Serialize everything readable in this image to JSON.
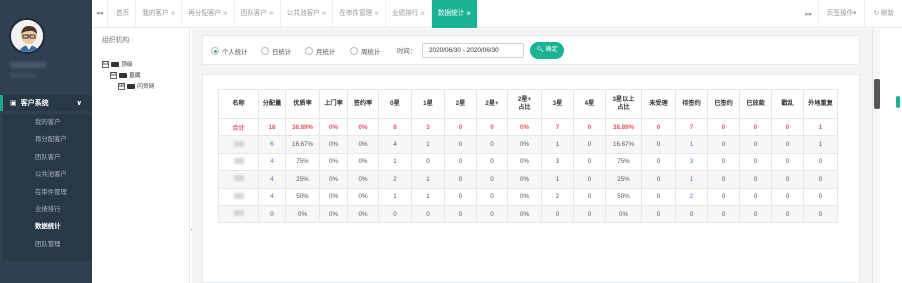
{
  "sidebar": {
    "menu_group": {
      "label": "客户系统",
      "icon": "archive-icon",
      "arrow": "∨"
    },
    "items": [
      {
        "label": "我的客户",
        "active": false
      },
      {
        "label": "再分配客户",
        "active": false
      },
      {
        "label": "团队客户",
        "active": false
      },
      {
        "label": "公共池客户",
        "active": false
      },
      {
        "label": "在审件管理",
        "active": false
      },
      {
        "label": "业绩排行",
        "active": false
      },
      {
        "label": "数据统计",
        "active": true
      },
      {
        "label": "团队管理",
        "active": false
      }
    ]
  },
  "tabbar": {
    "back_icon": "◂◂",
    "forward_icon": "▸▸",
    "tabs": [
      {
        "label": "首页",
        "closable": false,
        "active": false
      },
      {
        "label": "我的客户",
        "closable": true,
        "active": false
      },
      {
        "label": "再分配客户",
        "closable": true,
        "active": false
      },
      {
        "label": "团队客户",
        "closable": true,
        "active": false
      },
      {
        "label": "公共池客户",
        "closable": true,
        "active": false
      },
      {
        "label": "在审件管理",
        "closable": true,
        "active": false
      },
      {
        "label": "业绩排行",
        "closable": true,
        "active": false
      },
      {
        "label": "数据统计",
        "closable": true,
        "active": true
      }
    ],
    "close_glyph": "⊗",
    "page_ops": "页签操作▾",
    "refresh": "↻ 刷新"
  },
  "org": {
    "title": "组织机构",
    "tree": [
      {
        "toggle": "⊟",
        "label": "顶级",
        "indent": 0
      },
      {
        "toggle": "⊟",
        "label": "直属",
        "indent": 1
      },
      {
        "toggle": "⊞",
        "label": "闪贷网",
        "indent": 2
      }
    ]
  },
  "filters": {
    "radios": [
      {
        "label": "个人统计",
        "checked": true
      },
      {
        "label": "日统计",
        "checked": false
      },
      {
        "label": "月统计",
        "checked": false
      },
      {
        "label": "周统计",
        "checked": false
      }
    ],
    "time_label": "时间：",
    "time_value": "2020/06/30 - 2020/06/30",
    "confirm_label": "确定",
    "confirm_icon": "search-icon"
  },
  "table": {
    "headers": [
      "名称",
      "分配量",
      "优质率",
      "上门率",
      "签约率",
      "0星",
      "1星",
      "2星",
      "2星+",
      "2星+\n占比",
      "3星",
      "4星",
      "3星以上\n占比",
      "未受理",
      "待签约",
      "已签约",
      "已放款",
      "戳乱",
      "外地重复"
    ],
    "rows": [
      [
        "合计",
        "18",
        "38.89%",
        "0%",
        "0%",
        "8",
        "3",
        "0",
        "0",
        "0%",
        "7",
        "0",
        "38.89%",
        "0",
        "7",
        "0",
        "0",
        "0",
        "1"
      ],
      [
        "",
        "6",
        "16.67%",
        "0%",
        "0%",
        "4",
        "1",
        "0",
        "0",
        "0%",
        "1",
        "0",
        "16.67%",
        "0",
        "1",
        "0",
        "0",
        "0",
        "1"
      ],
      [
        "",
        "4",
        "75%",
        "0%",
        "0%",
        "1",
        "0",
        "0",
        "0",
        "0%",
        "3",
        "0",
        "75%",
        "0",
        "3",
        "0",
        "0",
        "0",
        "0"
      ],
      [
        "",
        "4",
        "25%",
        "0%",
        "0%",
        "2",
        "1",
        "0",
        "0",
        "0%",
        "1",
        "0",
        "25%",
        "0",
        "1",
        "0",
        "0",
        "0",
        "0"
      ],
      [
        "",
        "4",
        "50%",
        "0%",
        "0%",
        "1",
        "1",
        "0",
        "0",
        "0%",
        "2",
        "0",
        "50%",
        "0",
        "2",
        "0",
        "0",
        "0",
        "0"
      ],
      [
        "",
        "0",
        "0%",
        "0%",
        "0%",
        "0",
        "0",
        "0",
        "0",
        "0%",
        "0",
        "0",
        "0%",
        "0",
        "0",
        "0",
        "0",
        "0",
        "0"
      ]
    ],
    "total_color": "#ed5565",
    "link_color": "#3a7bd5"
  },
  "colors": {
    "accent": "#1ab394",
    "sidebar_bg": "#2f4050"
  }
}
